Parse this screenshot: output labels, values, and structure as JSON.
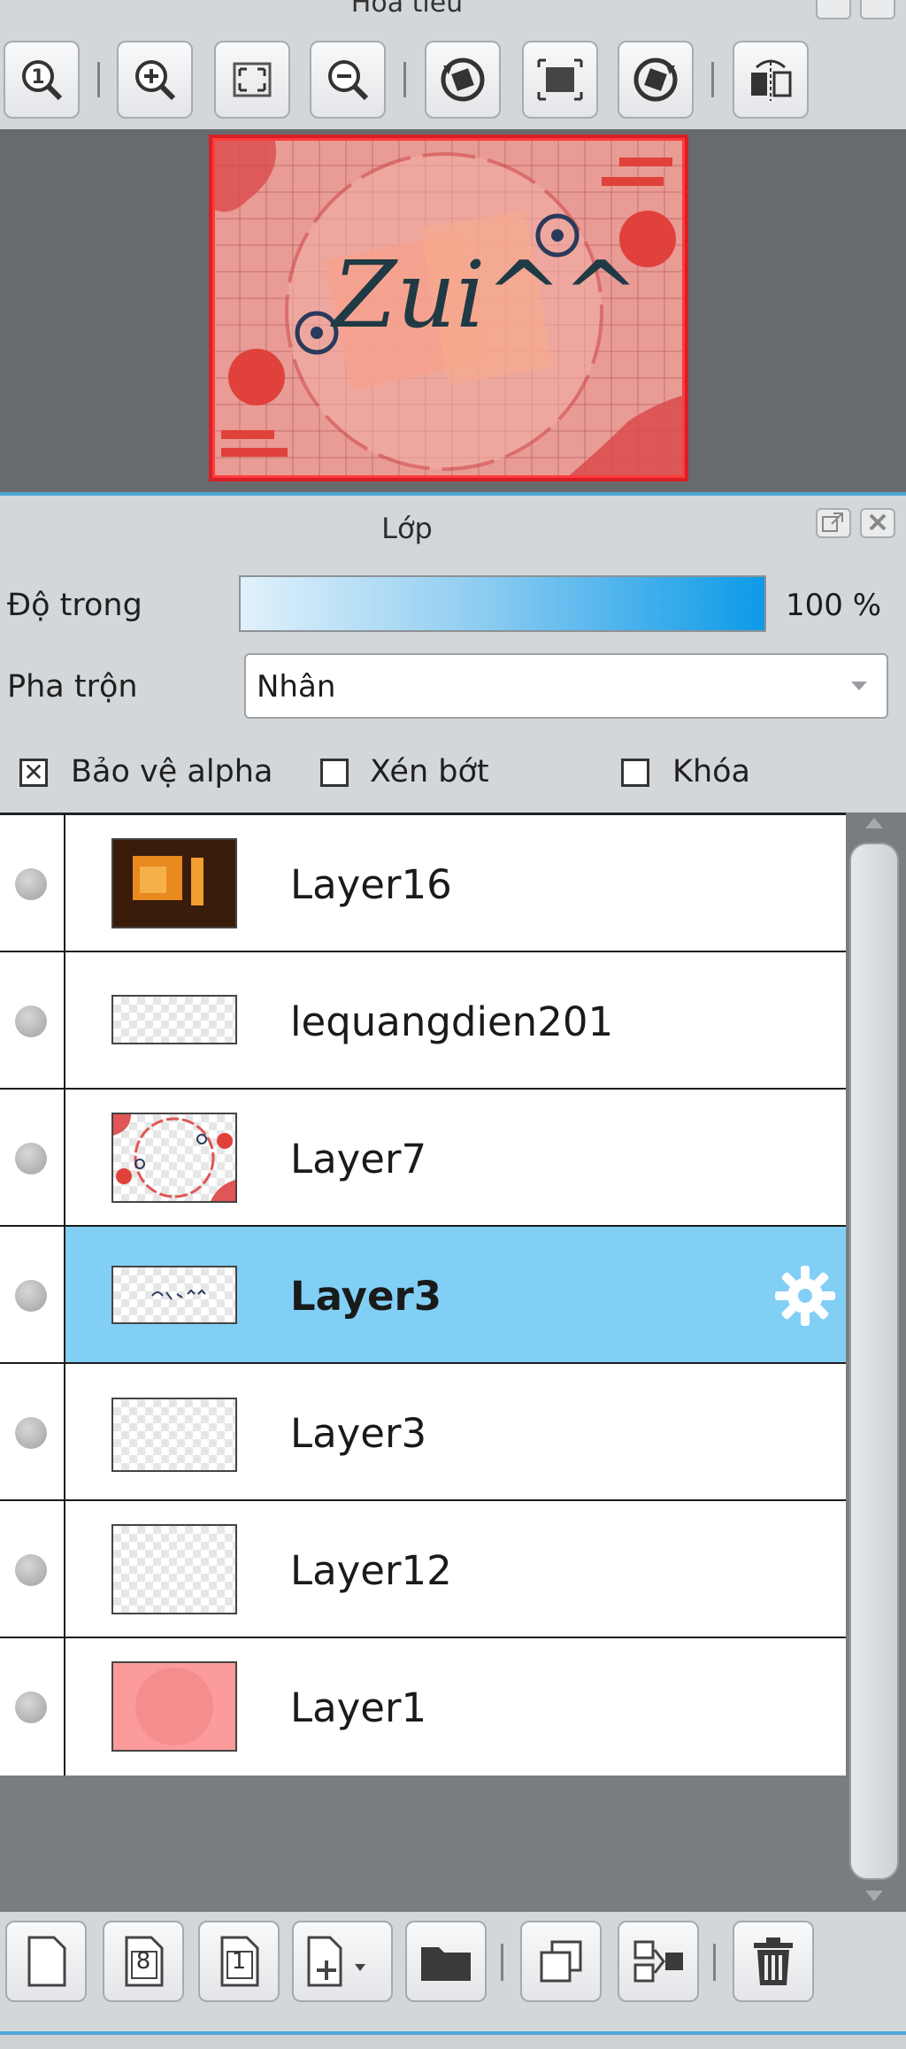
{
  "navigator": {
    "title": "Hoa tiêu"
  },
  "layer_panel": {
    "title": "Lớp",
    "opacity_label": "Độ trong",
    "opacity_value": "100 %",
    "opacity_fraction": 1.0,
    "blend_label": "Pha trộn",
    "blend_value": "Nhân",
    "checkboxes": [
      {
        "label": "Bảo vệ alpha",
        "checked": true
      },
      {
        "label": "Xén bớt",
        "checked": false
      },
      {
        "label": "Khóa",
        "checked": false
      }
    ],
    "layers": [
      {
        "name": "Layer16",
        "selected": false
      },
      {
        "name": "lequangdien201",
        "selected": false
      },
      {
        "name": "Layer7",
        "selected": false
      },
      {
        "name": "Layer3",
        "selected": true
      },
      {
        "name": "Layer3",
        "selected": false
      },
      {
        "name": "Layer12",
        "selected": false
      },
      {
        "name": "Layer1",
        "selected": false
      }
    ]
  },
  "preview": {
    "text": "Zui^^"
  },
  "colors": {
    "accent": "#4fa6d8",
    "selected_row": "#82cff6",
    "view_border": "#d91f26"
  },
  "toolbar_icons": [
    "zoom-actual-icon",
    "zoom-in-icon",
    "fit-screen-icon",
    "zoom-out-icon",
    "rotate-left-icon",
    "fit-canvas-icon",
    "rotate-right-icon",
    "flip-horizontal-icon"
  ],
  "bottom_icons": [
    "new-layer-icon",
    "new-8bit-layer-icon",
    "new-1bit-layer-icon",
    "add-layer-menu-icon",
    "folder-icon",
    "duplicate-layer-icon",
    "merge-layer-icon",
    "delete-layer-icon"
  ],
  "bottom_labels": {
    "layer_8bit": "8",
    "layer_1bit": "1"
  }
}
